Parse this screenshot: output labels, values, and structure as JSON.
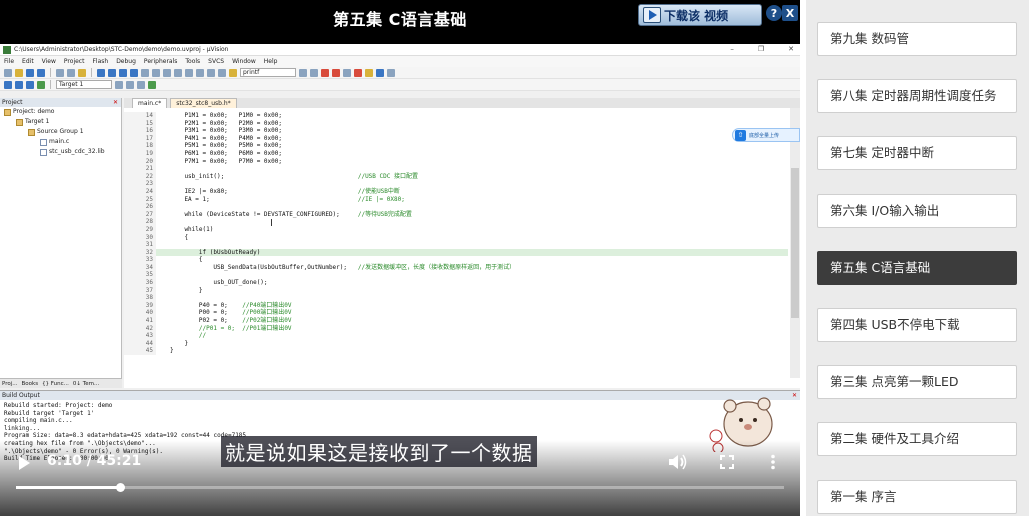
{
  "video": {
    "title": "第五集 C语言基础",
    "download_label": "下载该 视频",
    "help_label": "?",
    "close_label": "X",
    "subtitle": "就是说如果这是接收到了一个数据",
    "time": "6:10 / 45:21",
    "progress_fraction": 0.136
  },
  "ide": {
    "window_title": "C:\\Users\\Administrator\\Desktop\\STC-Demo\\demo\\demo.uvproj - µVision",
    "menu": [
      "File",
      "Edit",
      "View",
      "Project",
      "Flash",
      "Debug",
      "Peripherals",
      "Tools",
      "SVCS",
      "Window",
      "Help"
    ],
    "target_combo": "Target 1",
    "find_combo": "printf",
    "project_pane_title": "Project",
    "tree": [
      {
        "label": "Project: demo",
        "indent": 0,
        "kind": "folder"
      },
      {
        "label": "Target 1",
        "indent": 1,
        "kind": "folder"
      },
      {
        "label": "Source Group 1",
        "indent": 2,
        "kind": "folder"
      },
      {
        "label": "main.c",
        "indent": 3,
        "kind": "file"
      },
      {
        "label": "stc_usb_cdc_32.lib",
        "indent": 3,
        "kind": "file"
      }
    ],
    "project_tabs": [
      "Proj...",
      "Books",
      "{} Func...",
      "0↓ Tem..."
    ],
    "editor_tabs": [
      "main.c*",
      "stc32_stc8_usb.h*"
    ],
    "side_badge": "底部全量上传",
    "code": [
      {
        "n": "14",
        "t": "    P1M1 = 0x00;   P1M0 = 0x00;"
      },
      {
        "n": "15",
        "t": "    P2M1 = 0x00;   P2M0 = 0x00;"
      },
      {
        "n": "16",
        "t": "    P3M1 = 0x00;   P3M0 = 0x00;"
      },
      {
        "n": "17",
        "t": "    P4M1 = 0x00;   P4M0 = 0x00;"
      },
      {
        "n": "18",
        "t": "    P5M1 = 0x00;   P5M0 = 0x00;"
      },
      {
        "n": "19",
        "t": "    P6M1 = 0x00;   P6M0 = 0x00;"
      },
      {
        "n": "20",
        "t": "    P7M1 = 0x00;   P7M0 = 0x00;"
      },
      {
        "n": "21",
        "t": ""
      },
      {
        "n": "22",
        "t": "    usb_init();                                     ",
        "c": "//USB CDC 接口配置"
      },
      {
        "n": "23",
        "t": ""
      },
      {
        "n": "24",
        "t": "    IE2 |= 0x80;                                    ",
        "c": "//使能USB中断"
      },
      {
        "n": "25",
        "t": "    EA = 1;                                         ",
        "c": "//IE |= 0X80;"
      },
      {
        "n": "26",
        "t": ""
      },
      {
        "n": "27",
        "t": "    while (DeviceState != DEVSTATE_CONFIGURED);     ",
        "c": "//等待USB完成配置"
      },
      {
        "n": "28",
        "t": ""
      },
      {
        "n": "29",
        "t": "    while(1)"
      },
      {
        "n": "30",
        "t": "    {"
      },
      {
        "n": "31",
        "t": ""
      },
      {
        "n": "32",
        "t": "        if (bUsbOutReady)",
        "hl": true
      },
      {
        "n": "33",
        "t": "        {"
      },
      {
        "n": "34",
        "t": "            USB_SendData(UsbOutBuffer,OutNumber);   ",
        "c": "//发送数据缓冲区，长度（接收数据原样返回，用于测试）"
      },
      {
        "n": "35",
        "t": ""
      },
      {
        "n": "36",
        "t": "            usb_OUT_done();"
      },
      {
        "n": "37",
        "t": "        }"
      },
      {
        "n": "38",
        "t": ""
      },
      {
        "n": "39",
        "t": "        P40 = 0;    ",
        "c": "//P40端口输出0V"
      },
      {
        "n": "40",
        "t": "        P00 = 0;    ",
        "c": "//P00端口输出0V"
      },
      {
        "n": "41",
        "t": "        P02 = 0;    ",
        "c": "//P02端口输出0V"
      },
      {
        "n": "42",
        "t": "        ",
        "c": "//P01 = 0;  //P01端口输出0V"
      },
      {
        "n": "43",
        "t": "        ",
        "c": "//"
      },
      {
        "n": "44",
        "t": "    }"
      },
      {
        "n": "45",
        "t": "}"
      }
    ],
    "build_title": "Build Output",
    "build_log": [
      "Rebuild started: Project: demo",
      "Rebuild target 'Target 1'",
      "compiling main.c...",
      "linking...",
      "Program Size: data=8.3 edata+hdata=425 xdata=192 const=44 code=7185",
      "creating hex file from \".\\Objects\\demo\"...",
      "\".\\Objects\\demo\" - 0 Error(s), 0 Warning(s).",
      "Build Time Elapsed:  00:00:00"
    ]
  },
  "playlist": {
    "episodes": [
      {
        "label": "第九集 数码管",
        "active": false
      },
      {
        "label": "第八集 定时器周期性调度任务",
        "active": false
      },
      {
        "label": "第七集 定时器中断",
        "active": false
      },
      {
        "label": "第六集 I/O输入输出",
        "active": false
      },
      {
        "label": "第五集 C语言基础",
        "active": true
      },
      {
        "label": "第四集 USB不停电下载",
        "active": false
      },
      {
        "label": "第三集 点亮第一颗LED",
        "active": false
      },
      {
        "label": "第二集 硬件及工具介绍",
        "active": false
      },
      {
        "label": "第一集 序言",
        "active": false
      }
    ]
  },
  "colors": {
    "active_episode_bg": "#3c3c3c",
    "playlist_bg": "#ebebeb",
    "player_bg": "#000000",
    "code_comment": "#2a8a2a",
    "code_highlight_line": "#dcefdc"
  }
}
